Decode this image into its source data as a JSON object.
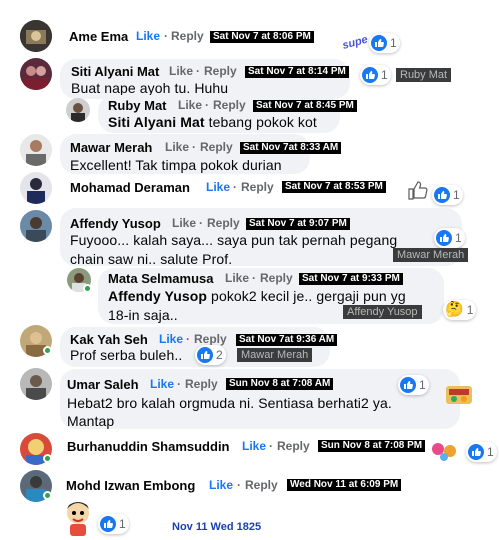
{
  "colors": {
    "link_blue": "#1877f2",
    "meta_grey": "#65676b",
    "bubble": "#f0f2f5",
    "online": "#31a24c",
    "stamp_bg": "#000000",
    "tag_bg": "#3a3b3c"
  },
  "labels": {
    "like": "Like",
    "reply": "Reply",
    "separator": "·"
  },
  "comments": [
    {
      "name": "Ame Ema",
      "time": "Sat Nov 7 at 8:06 PM",
      "reactions": "1",
      "like_state": "active"
    },
    {
      "name": "Siti Alyani Mat",
      "text": "Buat nape ayoh tu. Huhu",
      "time": "Sat Nov 7 at 8:14 PM",
      "reactions": "1",
      "tag": "Ruby Mat",
      "like_state": "default"
    },
    {
      "name": "Ruby Mat",
      "mention": "Siti Alyani Mat",
      "text": " tebang pokok kot",
      "time": "Sat Nov 7 at 8:45 PM",
      "like_state": "default"
    },
    {
      "name": "Mawar Merah",
      "text": "Excellent! Tak timpa pokok durian",
      "time": "Sat Nov  7at 8:33 AM",
      "like_state": "default"
    },
    {
      "name": "Mohamad Deraman",
      "time": "Sat Nov 7 at 8:53 PM",
      "reactions": "1",
      "like_state": "active"
    },
    {
      "name": "Affendy Yusop",
      "text_line1": "Fuyooo... kalah saya... saya pun tak pernah pegang",
      "text_line2": "chain saw ni.. salute Prof.",
      "time": "Sat Nov 7 at 9:07 PM",
      "reactions": "1",
      "tag": "Mawar Merah",
      "like_state": "default"
    },
    {
      "name": "Mata Selmamusa",
      "mention": "Affendy Yusop",
      "text_line1": " pokok2 kecil je.. gergaji pun yg",
      "text_line2": "18-in saja..",
      "time": "Sat Nov 7 at 9:33 PM",
      "reactions": "1",
      "tag": "Affendy Yusop",
      "like_state": "default"
    },
    {
      "name": "Kak Yah Seh",
      "text": "Prof serba buleh..",
      "time": "Sat Nov  7at 9:36 AM",
      "reactions": "2",
      "tag": "Mawar Merah",
      "like_state": "active"
    },
    {
      "name": "Umar Saleh",
      "text_line1": "Hebat2 bro kalah orgmuda ni. Sentiasa berhati2 ya.",
      "text_line2": "Mantap",
      "time": "Sun Nov 8 at 7:08 AM",
      "reactions": "1",
      "like_state": "active"
    },
    {
      "name": "Burhanuddin Shamsuddin",
      "time": "Sun Nov 8 at 7:08 PM",
      "reactions": "1",
      "like_state": "active"
    },
    {
      "name": "Mohd Izwan Embong",
      "time": "Wed Nov 11 at  6:09 PM",
      "reactions": "1",
      "like_state": "active"
    }
  ],
  "footer_time": "Nov 11 Wed 1825"
}
